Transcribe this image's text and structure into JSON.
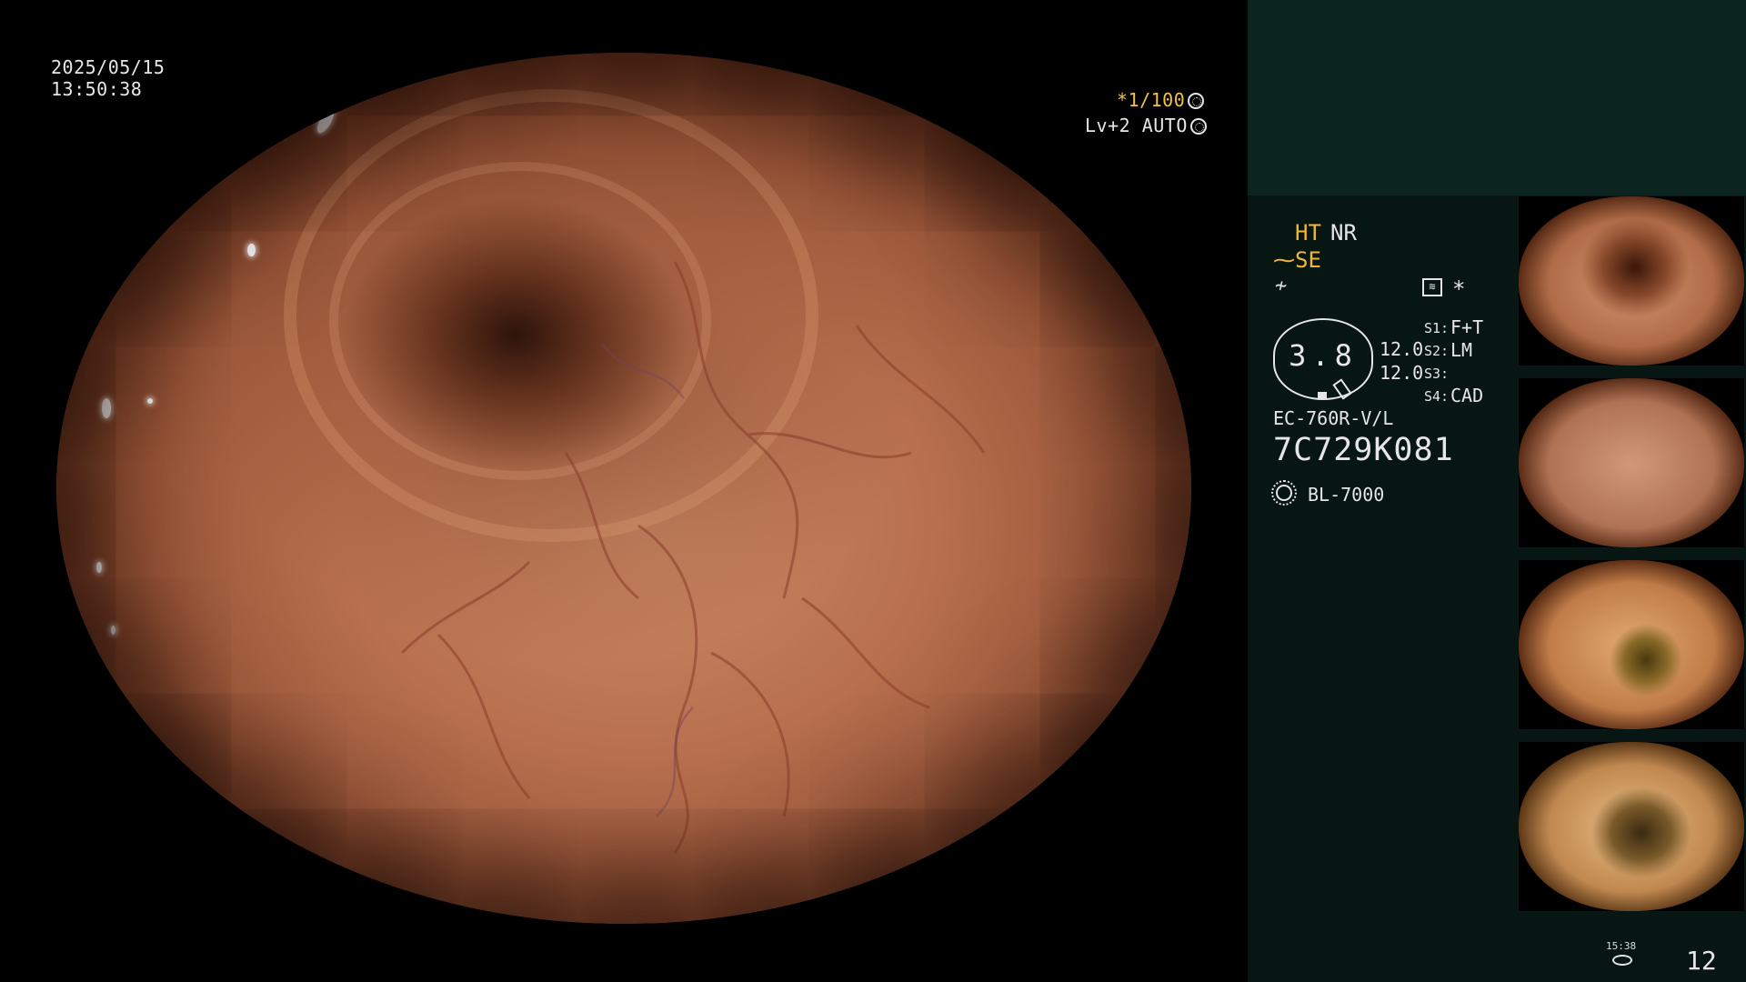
{
  "overlay": {
    "date": "2025/05/15",
    "time": "13:50:38",
    "shutter": "*1/100",
    "level": "Lv+2 AUTO"
  },
  "panel": {
    "ht": "HT",
    "nr": "NR",
    "se": "SE",
    "zoom": "3.8",
    "zoom_values": [
      "12.0",
      "12.0"
    ],
    "switches": [
      {
        "key": "S1:",
        "value": "F+T"
      },
      {
        "key": "S2:",
        "value": "LM"
      },
      {
        "key": "S3:",
        "value": ""
      },
      {
        "key": "S4:",
        "value": "CAD"
      }
    ],
    "scope_model": "EC-760R-V/L",
    "serial": "7C729K081",
    "light_source": "BL-7000",
    "record_time": "15:38",
    "image_count": "12"
  },
  "icons": {
    "shutter": "aperture-icon",
    "level": "iris-icon",
    "light": "light-source-icon",
    "storage": "disk-icon"
  },
  "colors": {
    "highlight": "#f0b832",
    "panel_bg": "#071613",
    "panel_top": "#0b2420"
  }
}
